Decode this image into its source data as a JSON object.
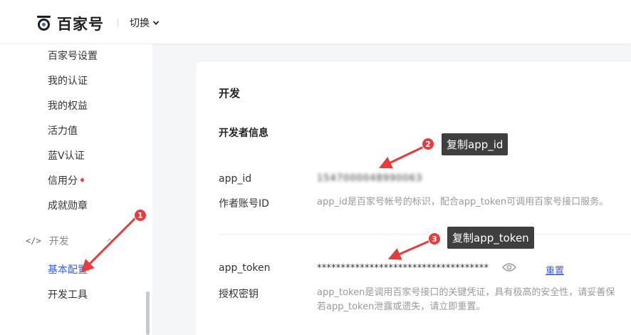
{
  "header": {
    "logo_text": "百家号",
    "switch_label": "切换"
  },
  "sidebar": {
    "items": [
      {
        "label": "百家号设置"
      },
      {
        "label": "我的认证"
      },
      {
        "label": "我的权益"
      },
      {
        "label": "活力值"
      },
      {
        "label": "蓝V认证"
      },
      {
        "label": "信用分",
        "badge_dot": true
      },
      {
        "label": "成就勋章"
      }
    ],
    "dev_group": {
      "label": "开发",
      "items": [
        {
          "label": "基本配置",
          "active": true
        },
        {
          "label": "开发工具"
        }
      ]
    }
  },
  "main": {
    "title": "开发",
    "section_title": "开发者信息",
    "app_id": {
      "label": "app_id",
      "value": "1547000048990063",
      "sub_label": "作者账号ID",
      "hint": "app_id是百家号帐号的标识，配合app_token可调用百家号接口服务。"
    },
    "app_token": {
      "label": "app_token",
      "value": "************************************",
      "sub_label": "授权密钥",
      "hint_line1": "app_token是调用百家号接口的关键凭证，具有极高的安全性，请妥善保",
      "hint_line2": "若app_token泄露或遗失，请立即重置。",
      "reset_label": "重置"
    }
  },
  "annotations": {
    "badge1": "1",
    "badge2": "2",
    "badge3": "3",
    "callout2": "复制app_id",
    "callout3": "复制app_token"
  },
  "colors": {
    "accent": "#3a5ee6",
    "annotation_red": "#e83b3b",
    "callout_bg": "#3f3f3f"
  }
}
